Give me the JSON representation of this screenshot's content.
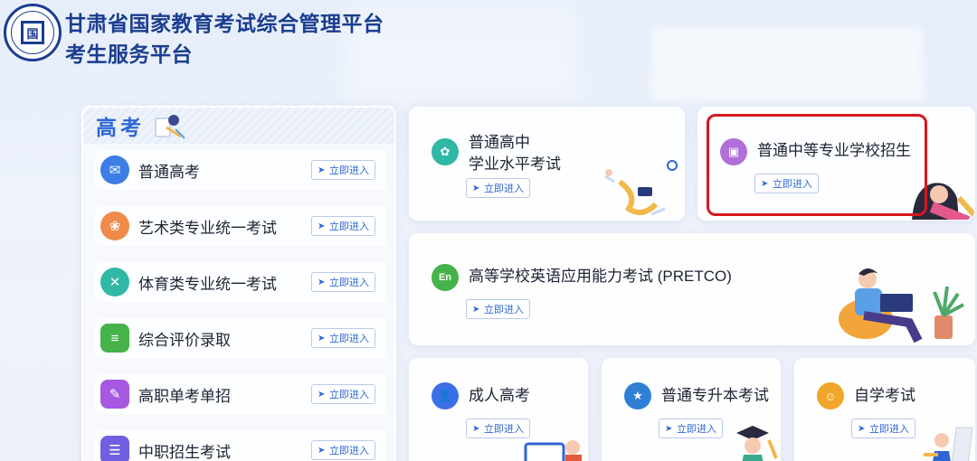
{
  "header": {
    "title_line1": "甘肃省国家教育考试综合管理平台",
    "title_line2": "考生服务平台",
    "logo_char": "国"
  },
  "gaokao": {
    "title": "高考",
    "items": [
      {
        "label": "普通高考",
        "color": "#3c7de6",
        "icon": "envelope-icon",
        "glyph": "✉"
      },
      {
        "label": "艺术类专业统一考试",
        "color": "#f08a4b",
        "icon": "lotus-icon",
        "glyph": "❀"
      },
      {
        "label": "体育类专业统一考试",
        "color": "#2fb8a3",
        "icon": "sport-icon",
        "glyph": "✕"
      },
      {
        "label": "综合评价录取",
        "color": "#45b349",
        "icon": "evaluation-icon",
        "glyph": "≡"
      },
      {
        "label": "高职单考单招",
        "color": "#a658e0",
        "icon": "document-icon",
        "glyph": "✎"
      },
      {
        "label": "中职招生考试",
        "color": "#6f5fe0",
        "icon": "list-icon",
        "glyph": "☰"
      }
    ]
  },
  "enter_label": "立即进入",
  "cards": {
    "xueye": {
      "line1": "普通高中",
      "line2": "学业水平考试",
      "color": "#2fb8a3",
      "icon": "badge-icon",
      "glyph": "✿"
    },
    "zhongzhi": {
      "label": "普通中等专业学校招生",
      "color": "#b06fd9",
      "icon": "id-card-icon",
      "glyph": "▣"
    },
    "pretco": {
      "label": "高等学校英语应用能力考试 (PRETCO)",
      "color": "#45b349",
      "icon": "en-icon",
      "glyph": "En"
    },
    "chengren": {
      "label": "成人高考",
      "color": "#3c6fe6",
      "icon": "user-icon",
      "glyph": "👤"
    },
    "zhuanshengben": {
      "label": "普通专升本考试",
      "color": "#2f7fd6",
      "icon": "star-icon",
      "glyph": "★"
    },
    "zixue": {
      "label": "自学考试",
      "color": "#f0a52b",
      "icon": "people-icon",
      "glyph": "☺"
    }
  }
}
